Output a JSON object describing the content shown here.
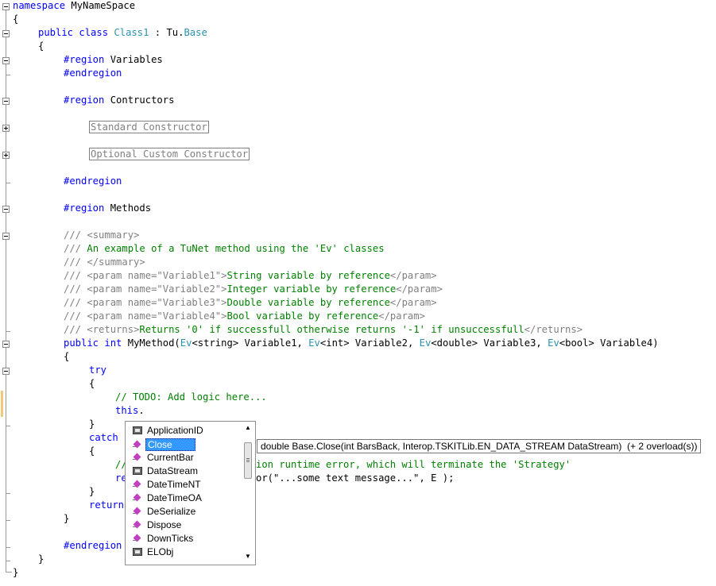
{
  "code": {
    "l1": [
      "namespace",
      " MyNameSpace"
    ],
    "l2": "{",
    "l3": [
      "public",
      "class",
      "Class1",
      " : Tu.",
      "Base"
    ],
    "l4": "{",
    "l5": [
      "#region",
      " Variables"
    ],
    "l6": "#endregion",
    "l7": [
      "#region",
      " Contructors"
    ],
    "l8": "Standard Constructor",
    "l9": "Optional Custom Constructor",
    "l10": "#endregion",
    "l11": [
      "#region",
      " Methods"
    ],
    "l12": [
      "///",
      " <summary>"
    ],
    "l13": [
      "///",
      " An example of a TuNet method using the 'Ev' classes"
    ],
    "l14": [
      "///",
      " </summary>"
    ],
    "params": [
      {
        "open": " <param name=\"Variable1\">",
        "text": "String variable by reference",
        "close": "</param>"
      },
      {
        "open": " <param name=\"Variable2\">",
        "text": "Integer variable by reference",
        "close": "</param>"
      },
      {
        "open": " <param name=\"Variable3\">",
        "text": "Double variable by reference",
        "close": "</param>"
      },
      {
        "open": " <param name=\"Variable4\">",
        "text": "Bool variable by reference",
        "close": "</param>"
      }
    ],
    "returns": {
      "open": " <returns>",
      "text": "Returns '0' if successfull otherwise returns '-1' if unsuccessfull",
      "close": "</returns>"
    },
    "sig": {
      "kw1": "public",
      "kw2": "int",
      "name": " MyMethod(",
      "p1t": "Ev",
      "p1k": "<string>",
      "p1n": " Variable1, ",
      "p2t": "Ev",
      "p2k": "<int>",
      "p2n": " Variable2, ",
      "p3t": "Ev",
      "p3k": "<double>",
      "p3n": " Variable3, ",
      "p4t": "Ev",
      "p4k": "<bool>",
      "p4n": " Variable4)"
    },
    "l_brace": "{",
    "try": "try",
    "todo": "// TODO: Add logic here...",
    "this_kw": "this",
    "this_dot": ".",
    "close_brace": "}",
    "catch": "catch",
    "comment_tail": "ion runtime error, which will terminate the 'Strategy'",
    "comment_head": "//",
    "call_head": "re",
    "call_tail": "or(\"...some text message...\", E );",
    "return_kw": "return",
    "endregion_last": "#endregion",
    "end_brace": "}"
  },
  "completion": {
    "items": [
      {
        "label": "ApplicationID",
        "icon": "property-icon"
      },
      {
        "label": "Close",
        "icon": "method-icon",
        "selected": true
      },
      {
        "label": "CurrentBar",
        "icon": "method-icon"
      },
      {
        "label": "DataStream",
        "icon": "property-icon"
      },
      {
        "label": "DateTimeNT",
        "icon": "method-icon"
      },
      {
        "label": "DateTimeOA",
        "icon": "method-icon"
      },
      {
        "label": "DeSerialize",
        "icon": "method-icon"
      },
      {
        "label": "Dispose",
        "icon": "method-icon"
      },
      {
        "label": "DownTicks",
        "icon": "method-icon"
      },
      {
        "label": "ELObj",
        "icon": "property-icon"
      }
    ]
  },
  "tooltip": {
    "text": "double Base.Close(int BarsBack, Interop.TSKITLib.EN_DATA_STREAM DataStream)  (+ 2 overload(s))"
  },
  "colors": {
    "keyword": "#0000ff",
    "type": "#2b91af",
    "comment": "#008000",
    "xmldoc": "#808080",
    "selection": "#3399ff"
  }
}
